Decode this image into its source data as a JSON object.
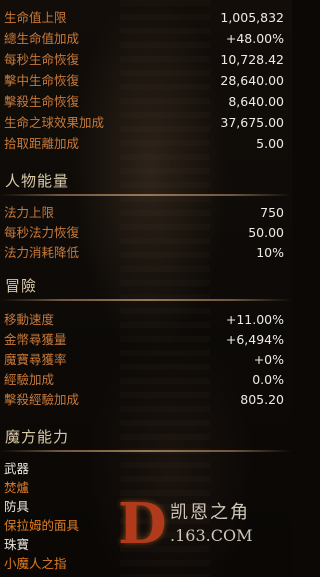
{
  "life": [
    {
      "label": "生命值上限",
      "value": "1,005,832"
    },
    {
      "label": "總生命值加成",
      "value": "+48.00%"
    },
    {
      "label": "每秒生命恢復",
      "value": "10,728.42"
    },
    {
      "label": "擊中生命恢復",
      "value": "28,640.00"
    },
    {
      "label": "擊殺生命恢復",
      "value": "8,640.00"
    },
    {
      "label": "生命之球效果加成",
      "value": "37,675.00"
    },
    {
      "label": "拾取距離加成",
      "value": "5.00"
    }
  ],
  "resource": {
    "title": "人物能量",
    "rows": [
      {
        "label": "法力上限",
        "value": "750"
      },
      {
        "label": "每秒法力恢復",
        "value": "50.00"
      },
      {
        "label": "法力消耗降低",
        "value": "10%"
      }
    ]
  },
  "adventure": {
    "title": "冒險",
    "rows": [
      {
        "label": "移動速度",
        "value": "+11.00%"
      },
      {
        "label": "金幣尋獲量",
        "value": "+6,494%"
      },
      {
        "label": "魔寶尋獲率",
        "value": "+0%"
      },
      {
        "label": "經驗加成",
        "value": "0.0%"
      },
      {
        "label": "擊殺經驗加成",
        "value": "805.20"
      }
    ]
  },
  "cube": {
    "title": "魔方能力",
    "items": [
      {
        "label": "武器",
        "color": "#eae6dd"
      },
      {
        "label": "焚爐",
        "color": "#e07c22"
      },
      {
        "label": "防具",
        "color": "#eae6dd"
      },
      {
        "label": "保拉姆的面具",
        "color": "#e07c22"
      },
      {
        "label": "珠寶",
        "color": "#eae6dd"
      },
      {
        "label": "小魔人之指",
        "color": "#e07c22"
      }
    ]
  },
  "watermark": {
    "logo_letter": "D",
    "name": "凯恩之角",
    "site": ".163.COM"
  }
}
